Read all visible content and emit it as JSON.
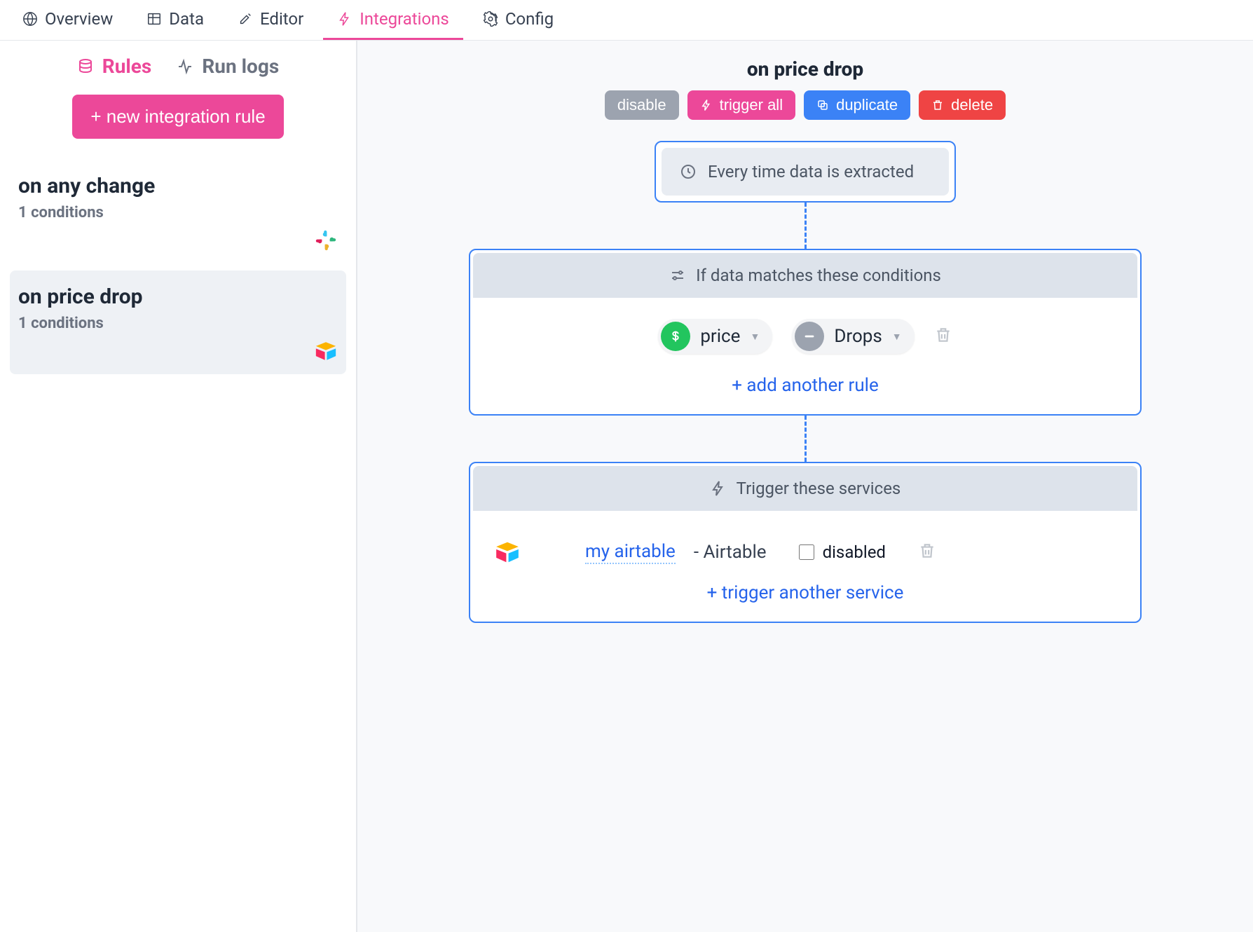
{
  "topnav": {
    "overview": "Overview",
    "data": "Data",
    "editor": "Editor",
    "integrations": "Integrations",
    "config": "Config"
  },
  "sidebar": {
    "tabs": {
      "rules": "Rules",
      "runlogs": "Run logs"
    },
    "new_button": "+ new integration rule",
    "rules": [
      {
        "title": "on any change",
        "conditions": "1 conditions",
        "service_icon": "slack"
      },
      {
        "title": "on price drop",
        "conditions": "1 conditions",
        "service_icon": "airtable"
      }
    ]
  },
  "main": {
    "title": "on price drop",
    "actions": {
      "disable": "disable",
      "trigger_all": "trigger all",
      "duplicate": "duplicate",
      "delete": "delete"
    },
    "trigger_node": "Every time data is extracted",
    "conditions_header": "If data matches these conditions",
    "condition": {
      "field": "price",
      "operator": "Drops"
    },
    "add_rule": "+ add another rule",
    "services_header": "Trigger these services",
    "service": {
      "name": "my airtable",
      "type": "Airtable",
      "disabled_label": "disabled"
    },
    "add_service": "+ trigger another service"
  }
}
